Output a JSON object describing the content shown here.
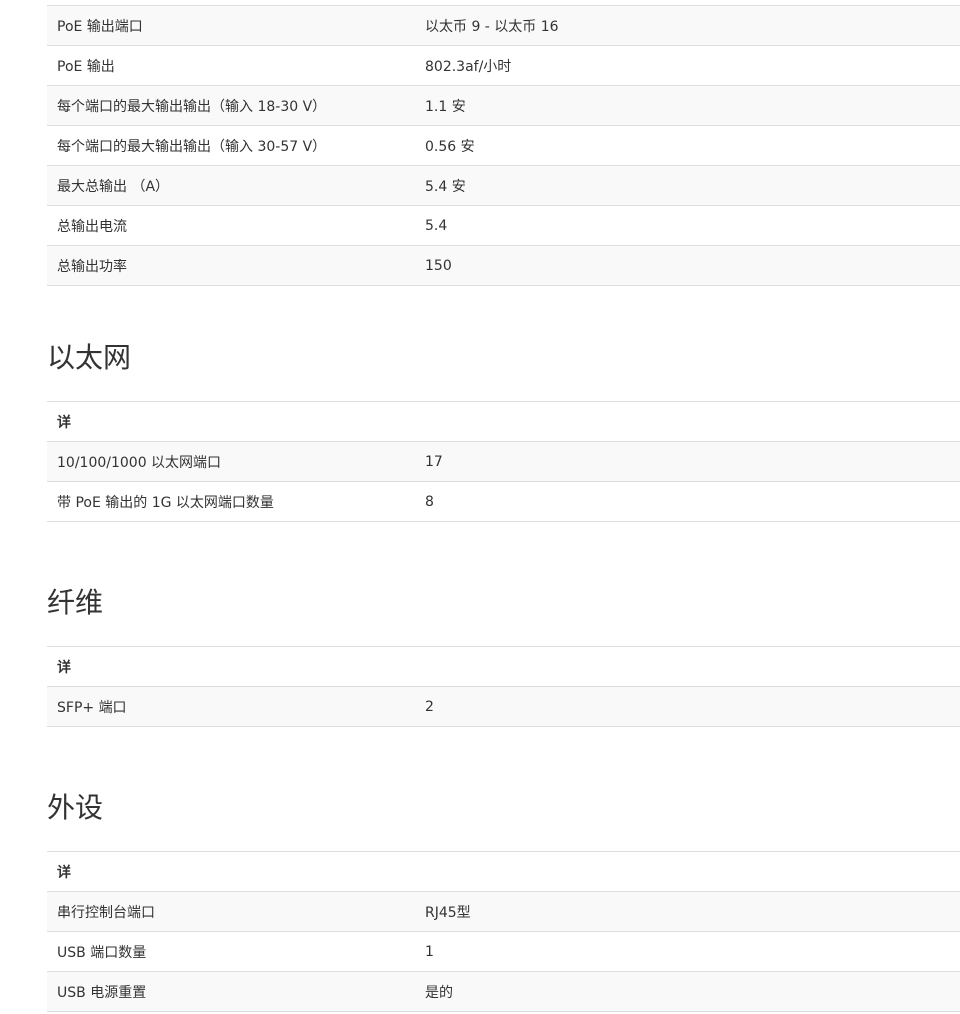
{
  "poe": {
    "rows": [
      {
        "label": "PoE 输出端口",
        "value": "以太币 9 - 以太币 16"
      },
      {
        "label": "PoE 输出",
        "value": "802.3af/小时"
      },
      {
        "label": "每个端口的最大输出输出（输入 18-30 V）",
        "value": "1.1 安"
      },
      {
        "label": "每个端口的最大输出输出（输入 30-57 V）",
        "value": "0.56 安"
      },
      {
        "label": "最大总输出 （A）",
        "value": "5.4 安"
      },
      {
        "label": "总输出电流",
        "value": "5.4"
      },
      {
        "label": "总输出功率",
        "value": "150"
      }
    ]
  },
  "ethernet": {
    "title": "以太网",
    "header": "详",
    "rows": [
      {
        "label": "10/100/1000 以太网端口",
        "value": "17"
      },
      {
        "label": "带 PoE 输出的 1G 以太网端口数量",
        "value": "8"
      }
    ]
  },
  "fiber": {
    "title": "纤维",
    "header": "详",
    "rows": [
      {
        "label": "SFP+ 端口",
        "value": "2"
      }
    ]
  },
  "peripherals": {
    "title": "外设",
    "header": "详",
    "rows": [
      {
        "label": "串行控制台端口",
        "value": "RJ45型"
      },
      {
        "label": "USB 端口数量",
        "value": "1"
      },
      {
        "label": "USB 电源重置",
        "value": "是的"
      }
    ]
  }
}
